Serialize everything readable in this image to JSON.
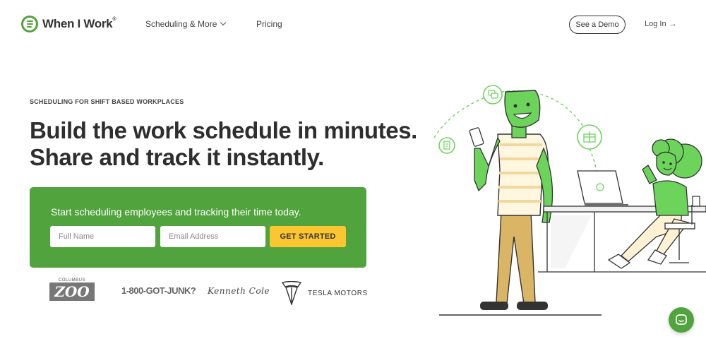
{
  "nav": {
    "brand": "When I Work",
    "brand_mark": "®",
    "scheduling": "Scheduling & More",
    "pricing": "Pricing",
    "demo": "See a Demo",
    "login": "Log In",
    "login_arrow": "→"
  },
  "hero": {
    "eyebrow": "SCHEDULING FOR SHIFT BASED WORKPLACES",
    "headline_1": "Build the work schedule in minutes.",
    "headline_2": "Share and track it instantly."
  },
  "signup": {
    "prompt": "Start scheduling employees and tracking their time today.",
    "name_placeholder": "Full Name",
    "email_placeholder": "Email Address",
    "cta": "GET STARTED"
  },
  "logos": {
    "zoo_top": "COLUMBUS",
    "zoo_main": "ZOO",
    "junk": "1-800-GOT-JUNK?",
    "cole": "Kenneth Cole",
    "tesla": "TESLA MOTORS"
  },
  "colors": {
    "brand_green": "#51a33d",
    "cta_yellow": "#fcc630",
    "character_green": "#6cd45a"
  },
  "icons": [
    "logo-icon",
    "chevron-down-icon",
    "arrow-right-icon",
    "chat-icon",
    "document-icon",
    "comment-icon",
    "gift-icon"
  ]
}
